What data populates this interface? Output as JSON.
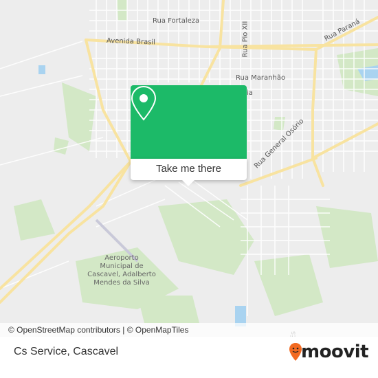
{
  "map": {
    "streets": [
      {
        "id": "rua-fortaleza",
        "label": "Rua Fortaleza"
      },
      {
        "id": "avenida-brasil",
        "label": "Avenida Brasil"
      },
      {
        "id": "rua-pio-xii",
        "label": "Rua Pio XII"
      },
      {
        "id": "rua-parana",
        "label": "Rua Paraná"
      },
      {
        "id": "rua-maranhao",
        "label": "Rua Maranhão"
      },
      {
        "id": "rua-general-osorio",
        "label": "Rua General Osório"
      },
      {
        "id": "partial-via",
        "label": "ia"
      },
      {
        "id": "partial-east",
        "label": "Es"
      }
    ],
    "pois": [
      {
        "id": "airport",
        "label": "Aeroporto\nMunicipal de\nCascavel, Adalberto\nMendes da Silva"
      }
    ],
    "colors": {
      "background": "#ededed",
      "park": "#cfe6c0",
      "road_major": "#fbe6a0",
      "road_minor": "#ffffff",
      "water": "#a9d3f0"
    }
  },
  "popup": {
    "icon": "map-pin-icon",
    "button_label": "Take me there",
    "accent": "#1cba68"
  },
  "attribution": {
    "text": "© OpenStreetMap contributors | © OpenMapTiles"
  },
  "footer": {
    "title": "Cs Service, Cascavel",
    "brand": "moovit",
    "brand_icon": "moovit-logo-icon",
    "brand_color": "#f26a21"
  }
}
